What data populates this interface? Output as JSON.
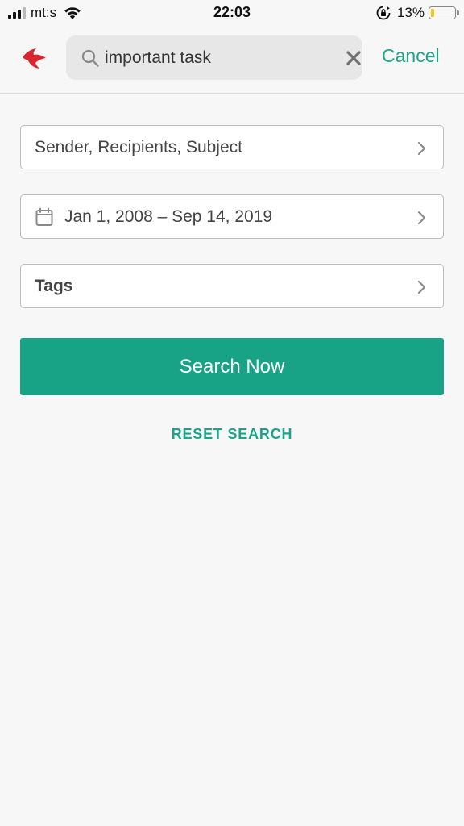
{
  "status_bar": {
    "carrier": "mt:s",
    "time": "22:03",
    "battery_percent": "13%",
    "battery_level": 0.13,
    "battery_color": "#f2c81d",
    "icons": [
      "signal-icon",
      "wifi-icon",
      "orientation-lock-icon",
      "battery-icon"
    ]
  },
  "header": {
    "logo_icon": "airmail-bird-logo",
    "search": {
      "value": "important task",
      "icon": "search-icon",
      "clear_icon": "close-icon"
    },
    "cancel_label": "Cancel"
  },
  "filters": {
    "people_placeholder": "Sender, Recipients, Subject",
    "date_range": "Jan 1, 2008 – Sep 14, 2019",
    "date_icon": "calendar-icon",
    "tags_label": "Tags",
    "chevron_icon": "chevron-right-icon"
  },
  "actions": {
    "search_now_label": "Search Now",
    "reset_label": "RESET SEARCH"
  },
  "colors": {
    "accent": "#18a286",
    "logo": "#d8262f",
    "background": "#f7f7f7"
  }
}
